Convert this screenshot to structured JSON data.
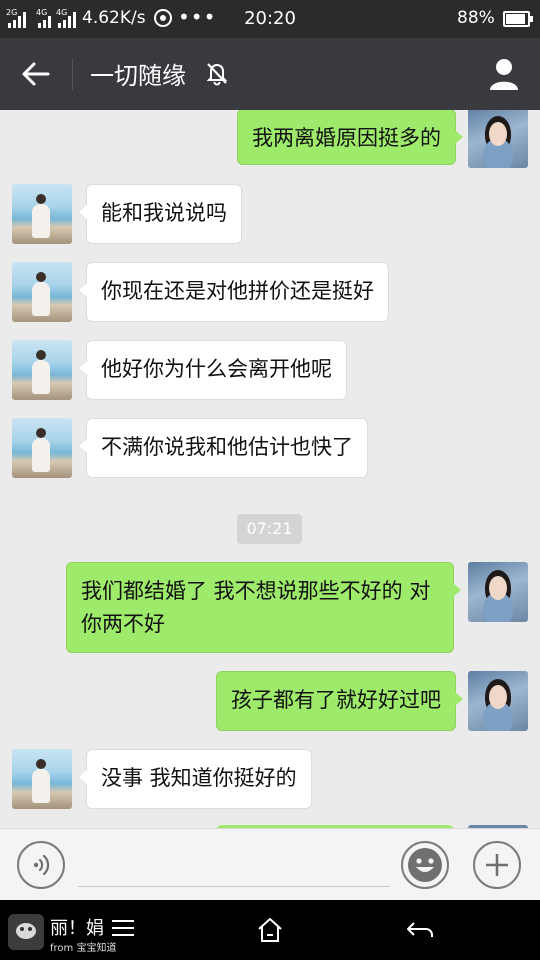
{
  "status_bar": {
    "signal_1_label": "2G",
    "signal_2_label": "4G",
    "signal_3_label": "4G",
    "network_speed": "4.62K/s",
    "more_dots": "•••",
    "time": "20:20",
    "battery_percent": "88%"
  },
  "header": {
    "title": "一切随缘",
    "back_icon": "arrow-left-icon",
    "mute_icon": "bell-muted-icon",
    "profile_icon": "person-icon"
  },
  "messages": [
    {
      "side": "out",
      "avatar": "lady",
      "text": "我两离婚原因挺多的"
    },
    {
      "side": "in",
      "avatar": "beach",
      "text": "能和我说说吗"
    },
    {
      "side": "in",
      "avatar": "beach",
      "text": "你现在还是对他拼价还是挺好"
    },
    {
      "side": "in",
      "avatar": "beach",
      "text": "他好你为什么会离开他呢"
    },
    {
      "side": "in",
      "avatar": "beach",
      "text": "不满你说我和他估计也快了"
    },
    {
      "side": "out",
      "avatar": "lady",
      "text": "我们都结婚了  我不想说那些不好的  对你两不好"
    },
    {
      "side": "out",
      "avatar": "lady",
      "text": "孩子都有了就好好过吧"
    },
    {
      "side": "in",
      "avatar": "beach",
      "text": "没事 我知道你挺好的"
    }
  ],
  "timestamp": "07:21",
  "input_bar": {
    "input_value": "",
    "voice_icon": "voice-icon",
    "emoji_icon": "emoji-icon",
    "plus_icon": "plus-icon"
  },
  "nav_bar": {
    "watermark_title": "丽！娟",
    "watermark_sub": "from 宝宝知道",
    "home_icon": "home-icon",
    "back_icon": "back-icon",
    "menu_icon": "menu-icon"
  },
  "colors": {
    "status_bar": "#2b2b2b",
    "header": "#393a3f",
    "chat_bg": "#ebebeb",
    "bubble_out": "#9eea6a",
    "bubble_in": "#ffffff"
  }
}
